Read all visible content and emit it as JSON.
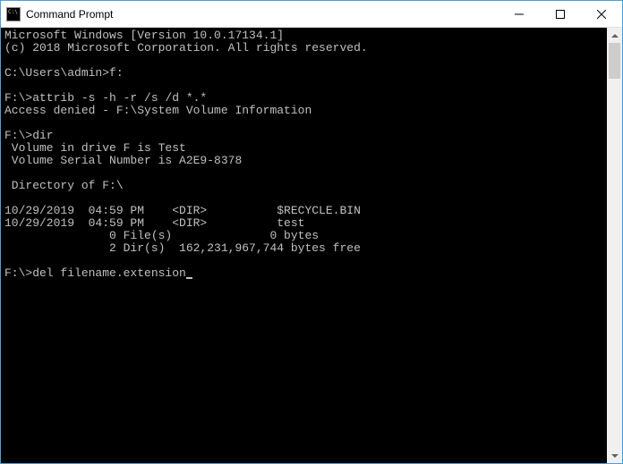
{
  "title": "Command Prompt",
  "lines": {
    "l0": "Microsoft Windows [Version 10.0.17134.1]",
    "l1": "(c) 2018 Microsoft Corporation. All rights reserved.",
    "l2": "",
    "l3": "C:\\Users\\admin>f:",
    "l4": "",
    "l5": "F:\\>attrib -s -h -r /s /d *.*",
    "l6": "Access denied - F:\\System Volume Information",
    "l7": "",
    "l8": "F:\\>dir",
    "l9": " Volume in drive F is Test",
    "l10": " Volume Serial Number is A2E9-8378",
    "l11": "",
    "l12": " Directory of F:\\",
    "l13": "",
    "l14": "10/29/2019  04:59 PM    <DIR>          $RECYCLE.BIN",
    "l15": "10/29/2019  04:59 PM    <DIR>          test",
    "l16": "               0 File(s)              0 bytes",
    "l17": "               2 Dir(s)  162,231,967,744 bytes free",
    "l18": "",
    "l19": "F:\\>del filename.extension"
  }
}
